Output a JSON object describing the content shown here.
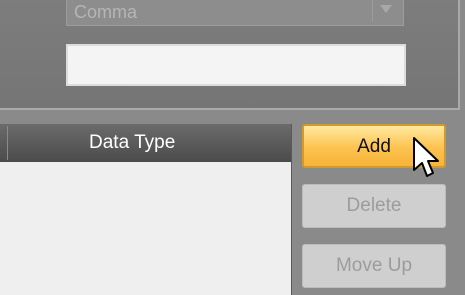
{
  "format_panel": {
    "delimiter_select": {
      "value": "Comma",
      "icon": "chevron-down-icon"
    },
    "text_field_value": ""
  },
  "grid": {
    "columns": [
      "Data Type"
    ]
  },
  "buttons": {
    "add_label": "Add",
    "delete_label": "Delete",
    "move_up_label": "Move Up"
  },
  "colors": {
    "add_button": "#fcc24f",
    "header": "#4b4b4b"
  }
}
